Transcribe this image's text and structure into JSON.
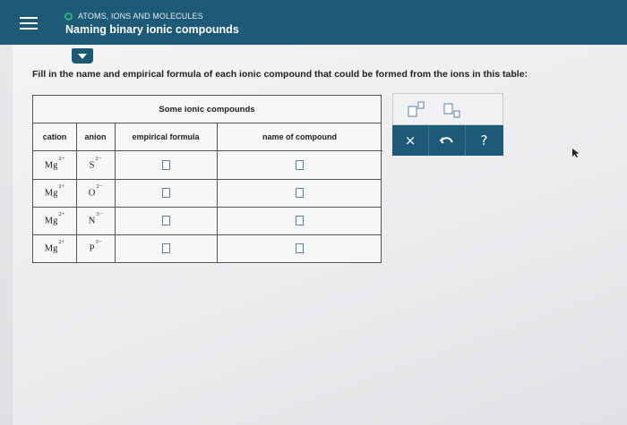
{
  "header": {
    "topic": "ATOMS, IONS AND MOLECULES",
    "title": "Naming binary ionic compounds",
    "colors": {
      "bar": "#1c5a78",
      "topic_dot": "#2fb470"
    }
  },
  "instruction": "Fill in the name and empirical formula of each ionic compound that could be formed from the ions in this table:",
  "table": {
    "caption": "Some ionic compounds",
    "columns": [
      "cation",
      "anion",
      "empirical formula",
      "name of compound"
    ],
    "rows": [
      {
        "cation": "Mg",
        "cation_charge": "2+",
        "anion": "S",
        "anion_charge": "2−",
        "empirical_formula": "",
        "name": ""
      },
      {
        "cation": "Mg",
        "cation_charge": "2+",
        "anion": "O",
        "anion_charge": "2−",
        "empirical_formula": "",
        "name": ""
      },
      {
        "cation": "Mg",
        "cation_charge": "2+",
        "anion": "N",
        "anion_charge": "3−",
        "empirical_formula": "",
        "name": ""
      },
      {
        "cation": "Mg",
        "cation_charge": "2+",
        "anion": "P",
        "anion_charge": "3−",
        "empirical_formula": "",
        "name": ""
      }
    ]
  },
  "toolbar": {
    "buttons": [
      {
        "name": "superscript-button",
        "icon": "superscript-template-icon"
      },
      {
        "name": "subscript-button",
        "icon": "subscript-template-icon"
      }
    ],
    "actions": [
      {
        "name": "clear-button",
        "glyph": "×"
      },
      {
        "name": "undo-button",
        "glyph": "↶"
      },
      {
        "name": "help-button",
        "glyph": "?"
      }
    ]
  }
}
